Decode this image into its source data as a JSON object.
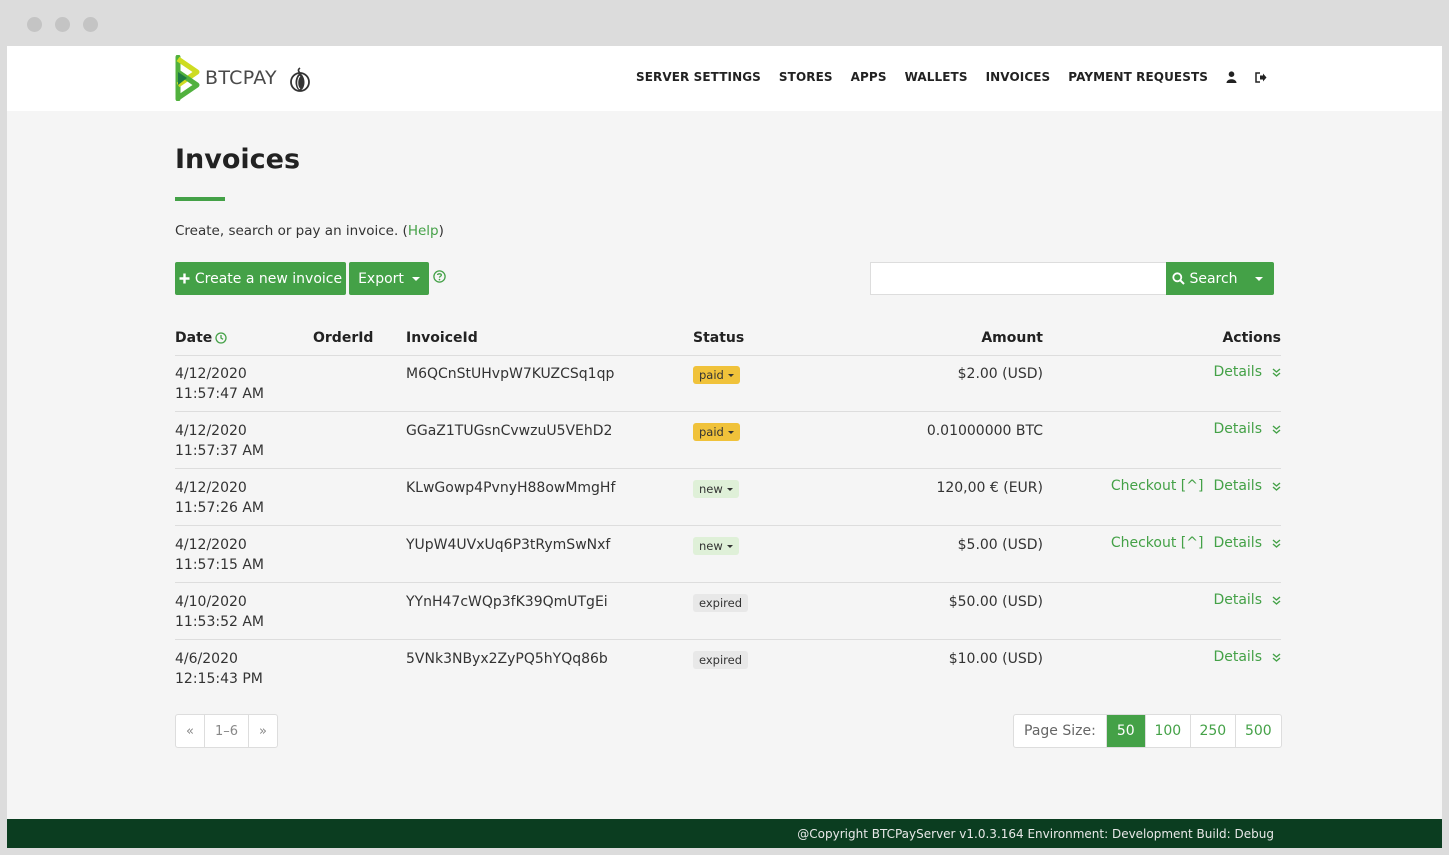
{
  "nav": {
    "brand": "BTCPAY",
    "links": [
      "SERVER SETTINGS",
      "STORES",
      "APPS",
      "WALLETS",
      "INVOICES",
      "PAYMENT REQUESTS"
    ]
  },
  "page": {
    "title": "Invoices",
    "intro": "Create, search or pay an invoice. (",
    "help_link": "Help",
    "intro_end": ")"
  },
  "toolbar": {
    "create_label": "Create a new invoice",
    "export_label": "Export",
    "search_placeholder": "",
    "search_label": "Search"
  },
  "table": {
    "headers": {
      "date": "Date",
      "order_id": "OrderId",
      "invoice_id": "InvoiceId",
      "status": "Status",
      "amount": "Amount",
      "actions": "Actions"
    },
    "rows": [
      {
        "date": "4/12/2020 11:57:47 AM",
        "order_id": "",
        "invoice_id": "M6QCnStUHvpW7KUZCSq1qp",
        "status": "paid",
        "amount": "$2.00 (USD)",
        "checkout": "",
        "details": "Details"
      },
      {
        "date": "4/12/2020 11:57:37 AM",
        "order_id": "",
        "invoice_id": "GGaZ1TUGsnCvwzuU5VEhD2",
        "status": "paid",
        "amount": "0.01000000 BTC",
        "checkout": "",
        "details": "Details"
      },
      {
        "date": "4/12/2020 11:57:26 AM",
        "order_id": "",
        "invoice_id": "KLwGowp4PvnyH88owMmgHf",
        "status": "new",
        "amount": "120,00 € (EUR)",
        "checkout": "Checkout [^]",
        "details": "Details"
      },
      {
        "date": "4/12/2020 11:57:15 AM",
        "order_id": "",
        "invoice_id": "YUpW4UVxUq6P3tRymSwNxf",
        "status": "new",
        "amount": "$5.00 (USD)",
        "checkout": "Checkout [^]",
        "details": "Details"
      },
      {
        "date": "4/10/2020 11:53:52 AM",
        "order_id": "",
        "invoice_id": "YYnH47cWQp3fK39QmUTgEi",
        "status": "expired",
        "amount": "$50.00 (USD)",
        "checkout": "",
        "details": "Details"
      },
      {
        "date": "4/6/2020 12:15:43 PM",
        "order_id": "",
        "invoice_id": "5VNk3NByx2ZyPQ5hYQq86b",
        "status": "expired",
        "amount": "$10.00 (USD)",
        "checkout": "",
        "details": "Details"
      }
    ]
  },
  "pager": {
    "prev": "«",
    "range": "1–6",
    "next": "»"
  },
  "page_size": {
    "label": "Page Size:",
    "options": [
      "50",
      "100",
      "250",
      "500"
    ],
    "selected": "50"
  },
  "footer": {
    "text": "@Copyright BTCPayServer v1.0.3.164 Environment: Development Build: Debug"
  },
  "colors": {
    "accent": "#44a147",
    "paid": "#f0c23a",
    "new": "#dff0d8",
    "expired": "#e8e8e8",
    "footer": "#0b3d20"
  }
}
